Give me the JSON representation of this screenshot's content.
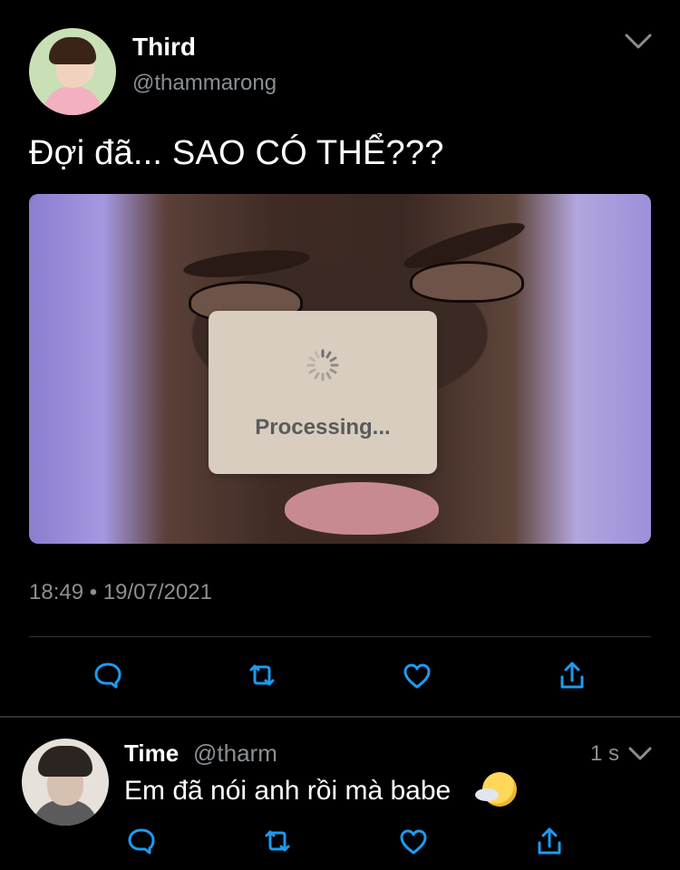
{
  "tweet": {
    "author_name": "Third",
    "author_handle": "@thammarong",
    "text": "Đợi đã... SAO CÓ THỂ???",
    "media_text": "Processing...",
    "timestamp": "18:49 • 19/07/2021",
    "actions": [
      {
        "name": "reply",
        "icon": "comment-icon"
      },
      {
        "name": "retweet",
        "icon": "retweet-icon"
      },
      {
        "name": "like",
        "icon": "heart-icon"
      },
      {
        "name": "share",
        "icon": "share-icon"
      }
    ]
  },
  "reply": {
    "author_name": "Time",
    "author_handle": "@tharm",
    "time": "1 s",
    "text": "Em đã nói anh rồi mà babe",
    "emoji_icon": "wind-face-emoji",
    "actions": [
      {
        "name": "reply",
        "icon": "comment-icon"
      },
      {
        "name": "retweet",
        "icon": "retweet-icon"
      },
      {
        "name": "like",
        "icon": "heart-icon"
      },
      {
        "name": "share",
        "icon": "share-icon"
      }
    ]
  },
  "colors": {
    "background": "#000000",
    "text_primary": "#ffffff",
    "text_secondary": "#8a8f94",
    "divider": "#2f3336"
  }
}
